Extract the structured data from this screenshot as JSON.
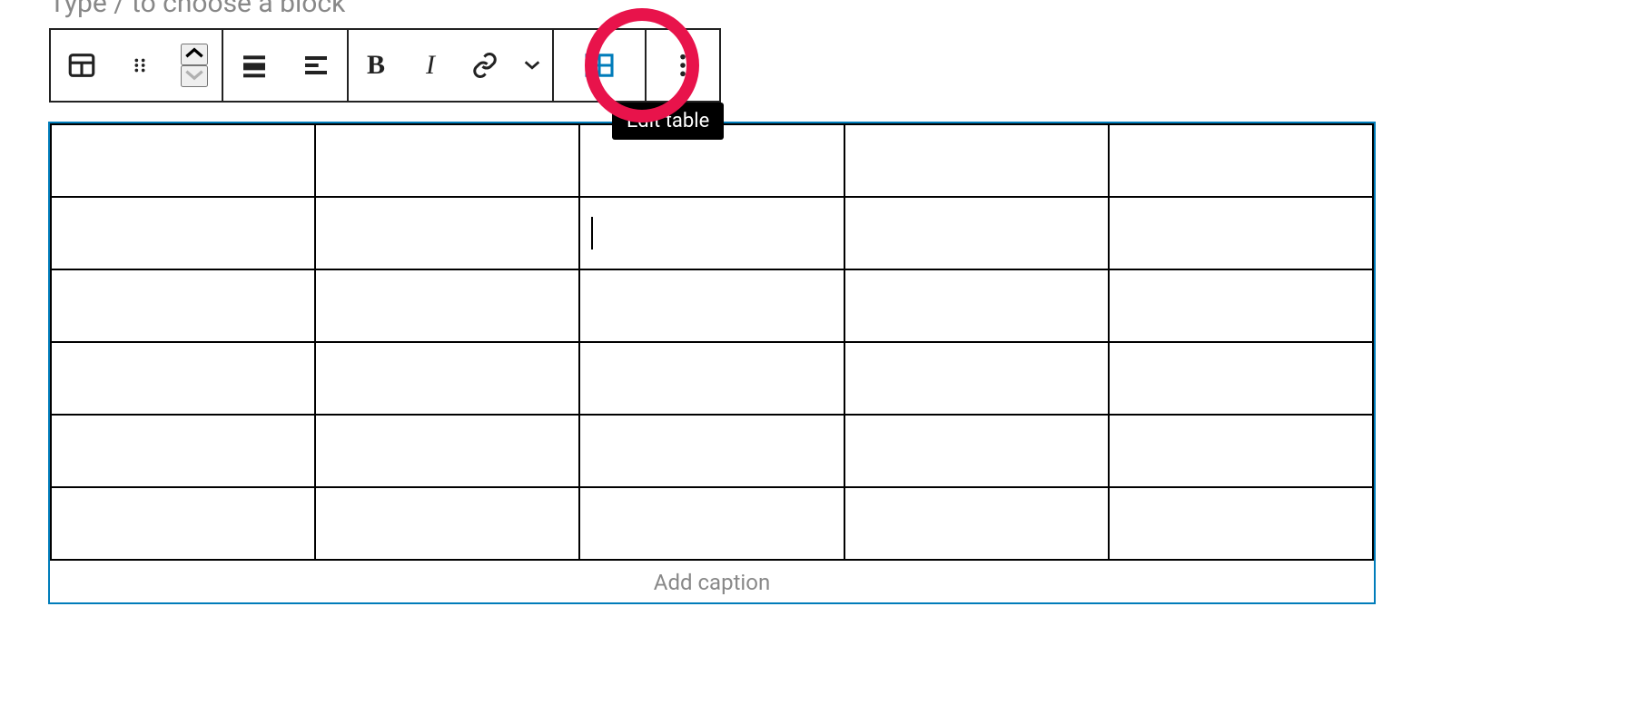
{
  "hint_text": "Type / to choose a block",
  "toolbar": {
    "block_type": "Table",
    "drag": "Drag",
    "move_up": "Move up",
    "move_down": "Move down",
    "align": "Change alignment",
    "text_align": "Change text alignment",
    "bold": "Bold",
    "italic": "Italic",
    "link": "Link",
    "more_rich": "More rich text controls",
    "edit_table": "Edit table",
    "options": "Options"
  },
  "tooltip": "Edit table",
  "table": {
    "rows": 6,
    "cols": 5,
    "cursor_row": 1,
    "cursor_col": 2
  },
  "caption_placeholder": "Add caption",
  "colors": {
    "accent": "#007cba",
    "highlight": "#e8134b"
  }
}
